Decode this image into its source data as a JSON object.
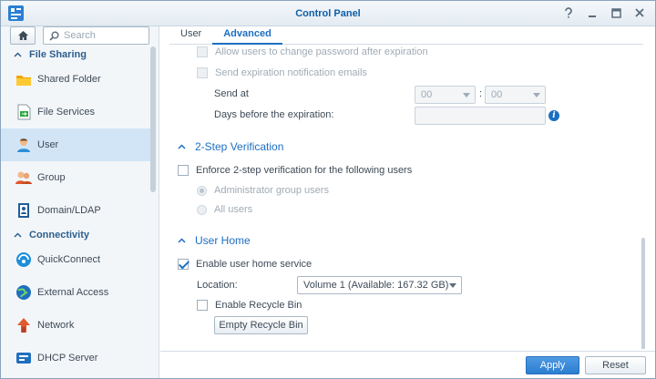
{
  "window": {
    "title": "Control Panel"
  },
  "sidebar": {
    "search_placeholder": "Search",
    "sections": [
      {
        "label": "File Sharing",
        "items": [
          {
            "label": "Shared Folder",
            "icon": "folder-icon"
          },
          {
            "label": "File Services",
            "icon": "file-services-icon"
          },
          {
            "label": "User",
            "icon": "user-icon",
            "selected": true
          },
          {
            "label": "Group",
            "icon": "group-icon"
          },
          {
            "label": "Domain/LDAP",
            "icon": "domain-icon"
          }
        ]
      },
      {
        "label": "Connectivity",
        "items": [
          {
            "label": "QuickConnect",
            "icon": "quickconnect-icon"
          },
          {
            "label": "External Access",
            "icon": "globe-icon"
          },
          {
            "label": "Network",
            "icon": "network-icon"
          },
          {
            "label": "DHCP Server",
            "icon": "dhcp-icon"
          }
        ]
      }
    ]
  },
  "tabs": [
    {
      "label": "User"
    },
    {
      "label": "Advanced",
      "active": true
    }
  ],
  "password_expiry": {
    "allow_change_label": "Allow users to change password after expiration",
    "send_notification_label": "Send expiration notification emails",
    "send_at_label": "Send at",
    "hour": "00",
    "separator": ":",
    "minute": "00",
    "days_before_label": "Days before the expiration:",
    "days_value": ""
  },
  "two_step": {
    "title": "2-Step Verification",
    "enforce_label": "Enforce 2-step verification for the following users",
    "admin_label": "Administrator group users",
    "all_label": "All users"
  },
  "user_home": {
    "title": "User Home",
    "enable_label": "Enable user home service",
    "location_label": "Location:",
    "location_value": "Volume 1 (Available: 167.32 GB)",
    "recycle_label": "Enable Recycle Bin",
    "empty_button": "Empty Recycle Bin"
  },
  "footer": {
    "apply": "Apply",
    "reset": "Reset"
  },
  "colors": {
    "accent": "#1b6fc2",
    "selected_bg": "#d2e5f7"
  }
}
